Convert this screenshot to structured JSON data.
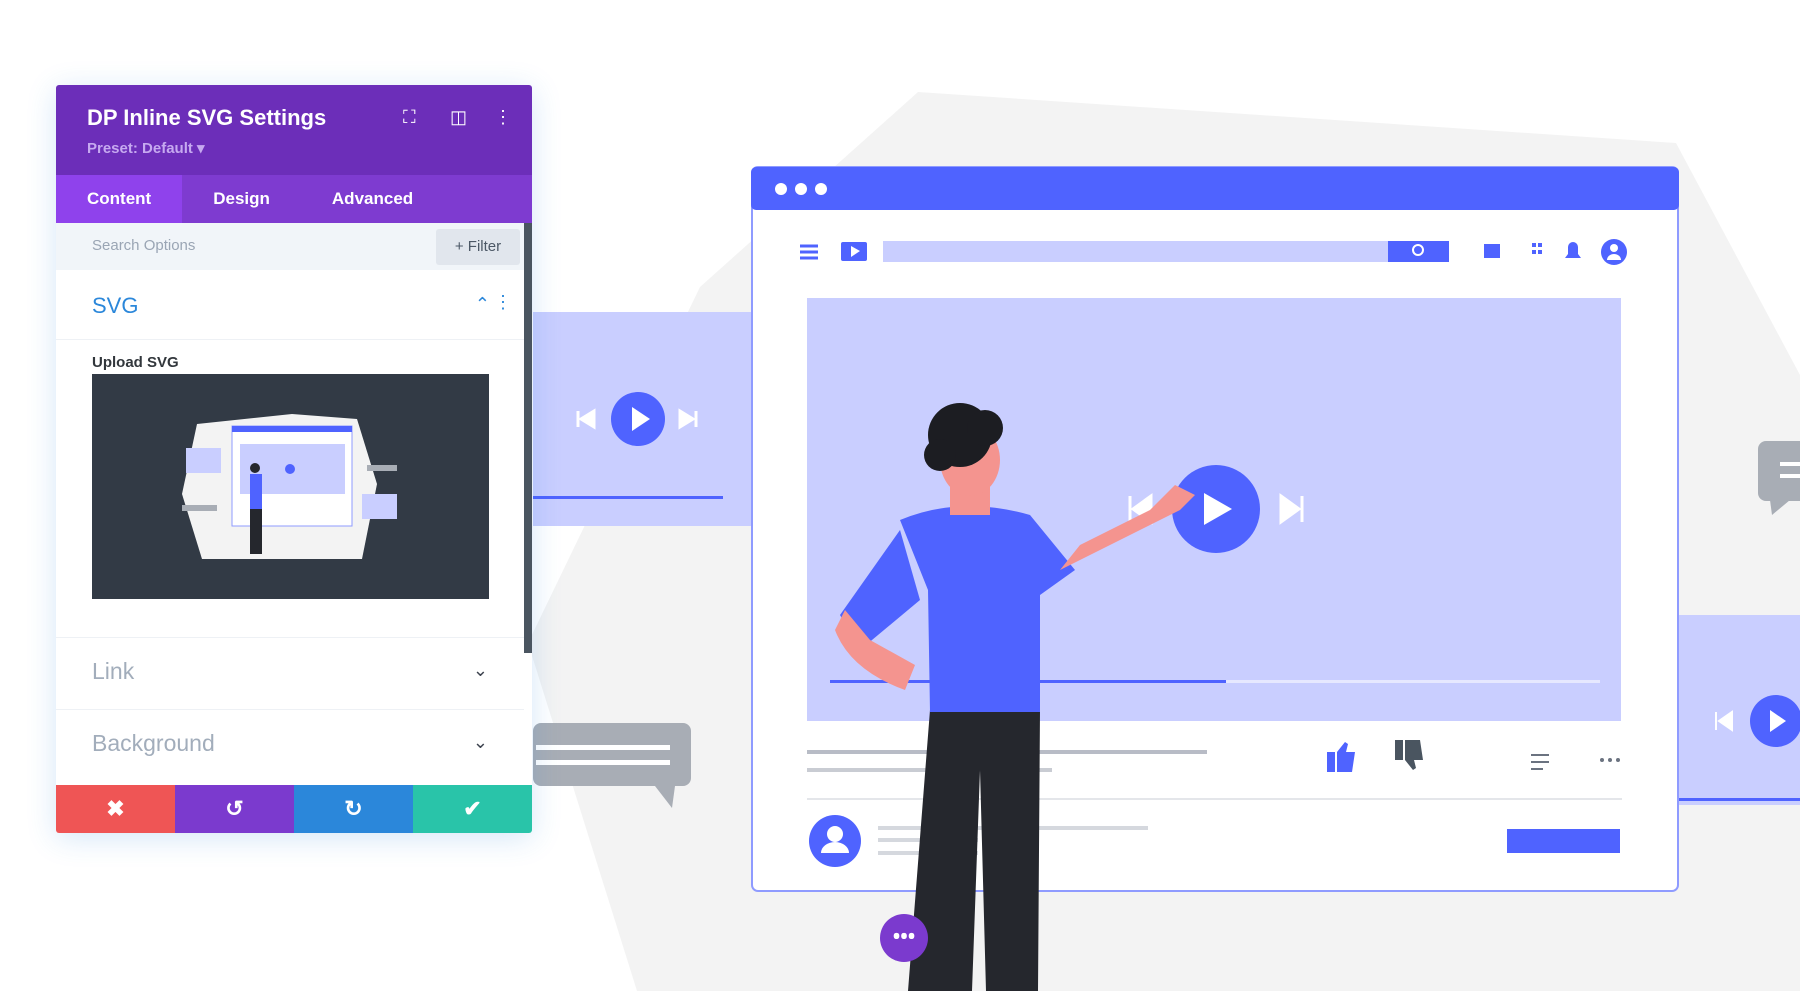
{
  "panel": {
    "title": "DP Inline SVG Settings",
    "preset": "Preset: Default ▾",
    "tabs": [
      {
        "label": "Content"
      },
      {
        "label": "Design"
      },
      {
        "label": "Advanced"
      }
    ],
    "search_placeholder": "Search Options",
    "filter_label": "+ Filter",
    "sections": {
      "svg": "SVG",
      "upload_label": "Upload SVG",
      "link": "Link",
      "background": "Background"
    },
    "icons": {
      "expand": "⛶",
      "layout": "◫",
      "more": "⋮",
      "collapse": "⌃",
      "chevron": "⌄"
    },
    "actions": {
      "cancel": "✖",
      "undo": "↺",
      "redo": "↻",
      "save": "✔"
    }
  },
  "colors": {
    "header": "#6c2eb9",
    "tab_bar": "#7e3bd0",
    "accent": "#4f63ff",
    "cancel": "#ef5555",
    "undo": "#7b3ace",
    "redo": "#2b87da",
    "save": "#29c4a9"
  },
  "illustration": {
    "video_progress": 0.55
  }
}
